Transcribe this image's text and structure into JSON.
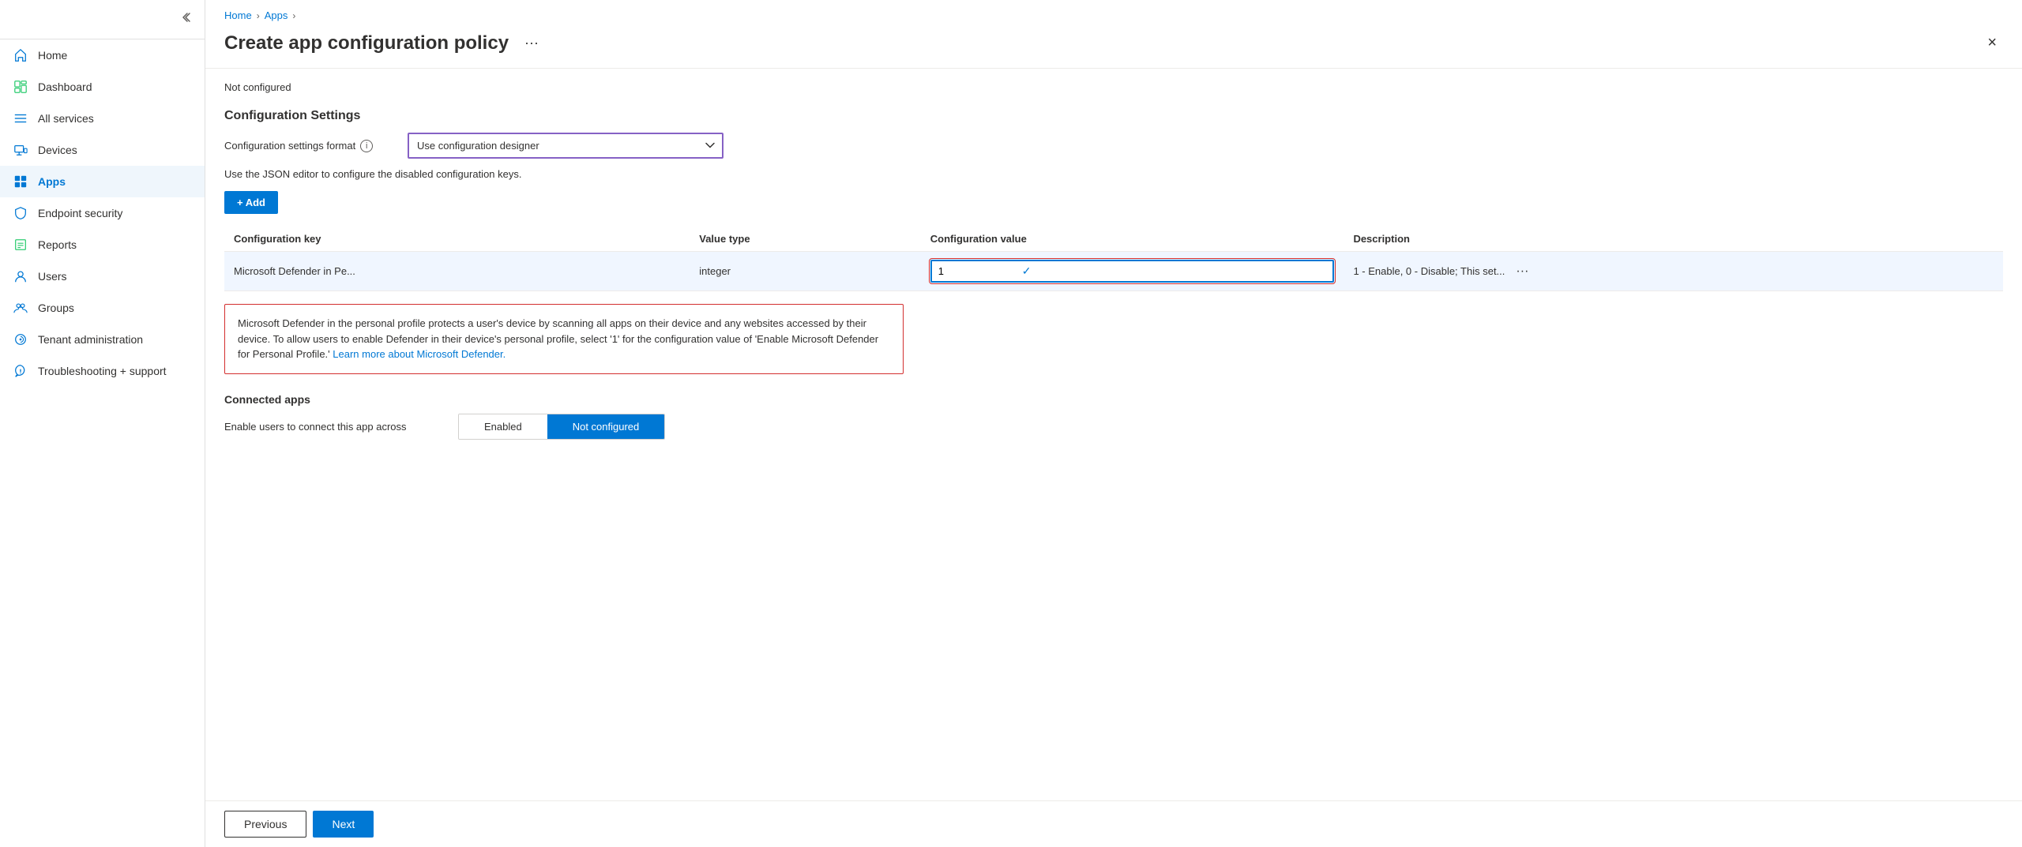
{
  "sidebar": {
    "collapse_title": "Collapse sidebar",
    "items": [
      {
        "id": "home",
        "label": "Home",
        "icon": "home",
        "active": false
      },
      {
        "id": "dashboard",
        "label": "Dashboard",
        "icon": "dashboard",
        "active": false
      },
      {
        "id": "all-services",
        "label": "All services",
        "icon": "all-services",
        "active": false
      },
      {
        "id": "devices",
        "label": "Devices",
        "icon": "devices",
        "active": false
      },
      {
        "id": "apps",
        "label": "Apps",
        "icon": "apps",
        "active": true
      },
      {
        "id": "endpoint-security",
        "label": "Endpoint security",
        "icon": "security",
        "active": false
      },
      {
        "id": "reports",
        "label": "Reports",
        "icon": "reports",
        "active": false
      },
      {
        "id": "users",
        "label": "Users",
        "icon": "users",
        "active": false
      },
      {
        "id": "groups",
        "label": "Groups",
        "icon": "groups",
        "active": false
      },
      {
        "id": "tenant-administration",
        "label": "Tenant administration",
        "icon": "tenant",
        "active": false
      },
      {
        "id": "troubleshooting-support",
        "label": "Troubleshooting + support",
        "icon": "troubleshoot",
        "active": false
      }
    ]
  },
  "breadcrumb": {
    "items": [
      "Home",
      "Apps"
    ],
    "separators": [
      "›",
      "›"
    ]
  },
  "page": {
    "title": "Create app configuration policy",
    "more_label": "···",
    "close_label": "×"
  },
  "form": {
    "not_configured_label": "Not configured",
    "config_settings_title": "Configuration Settings",
    "config_format_label": "Configuration settings format",
    "config_format_info": "i",
    "config_format_value": "Use configuration designer",
    "json_hint": "Use the JSON editor to configure the disabled configuration keys.",
    "add_button_label": "+ Add",
    "table": {
      "columns": [
        "Configuration key",
        "Value type",
        "Configuration value",
        "Description"
      ],
      "rows": [
        {
          "key": "Microsoft Defender in Pe...",
          "value_type": "integer",
          "config_value": "1",
          "description": "1 - Enable, 0 - Disable; This set..."
        }
      ]
    },
    "info_box_text": "Microsoft Defender in the personal profile protects a user's device by scanning all apps on their device and any websites accessed by their device. To allow users to enable Defender in their device's personal profile, select '1' for the configuration value of 'Enable Microsoft Defender for Personal Profile.'",
    "info_box_link_text": "Learn more about Microsoft Defender.",
    "info_box_link_href": "#",
    "connected_apps_title": "Connected apps",
    "connected_apps_row_label": "Enable users to connect this app across",
    "toggle_options": [
      "Enabled",
      "Not configured"
    ],
    "toggle_active": "Not configured"
  },
  "footer": {
    "prev_label": "Previous",
    "next_label": "Next"
  }
}
